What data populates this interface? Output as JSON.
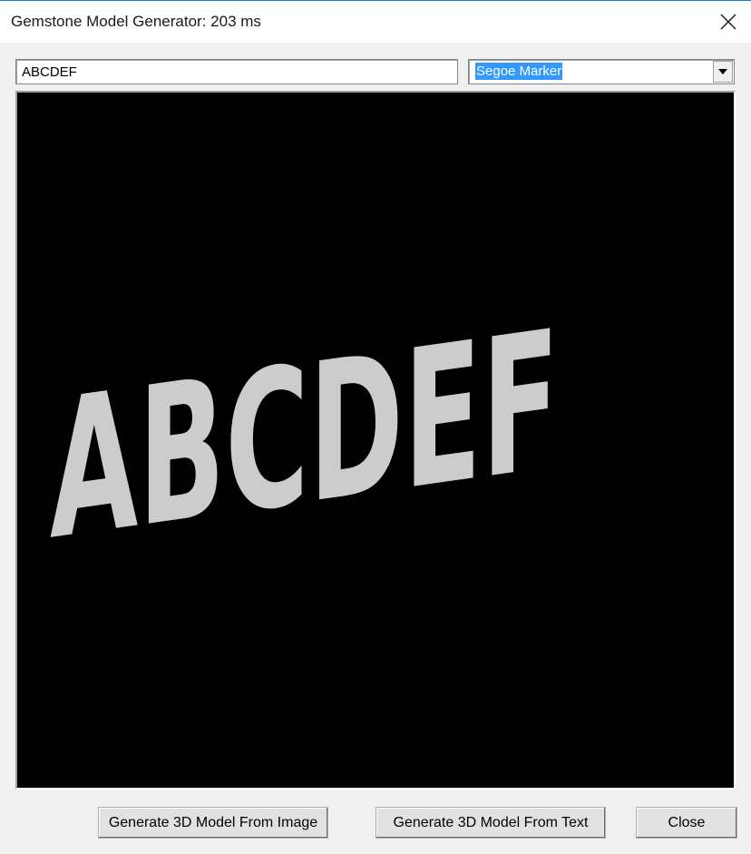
{
  "window": {
    "title": "Gemstone Model Generator: 203 ms"
  },
  "input": {
    "text_value": "ABCDEF"
  },
  "font_select": {
    "selected": "Segoe Marker"
  },
  "preview": {
    "rendered_text": "ABCDEF"
  },
  "buttons": {
    "from_image": "Generate 3D Model From Image",
    "from_text": "Generate 3D Model From Text",
    "close": "Close"
  },
  "icons": {
    "close": "close-icon",
    "dropdown": "chevron-down-icon"
  },
  "colors": {
    "title_accent": "#1979ca",
    "selection": "#3399ff",
    "preview_bg": "#000000",
    "preview_text": "#cccccc"
  }
}
